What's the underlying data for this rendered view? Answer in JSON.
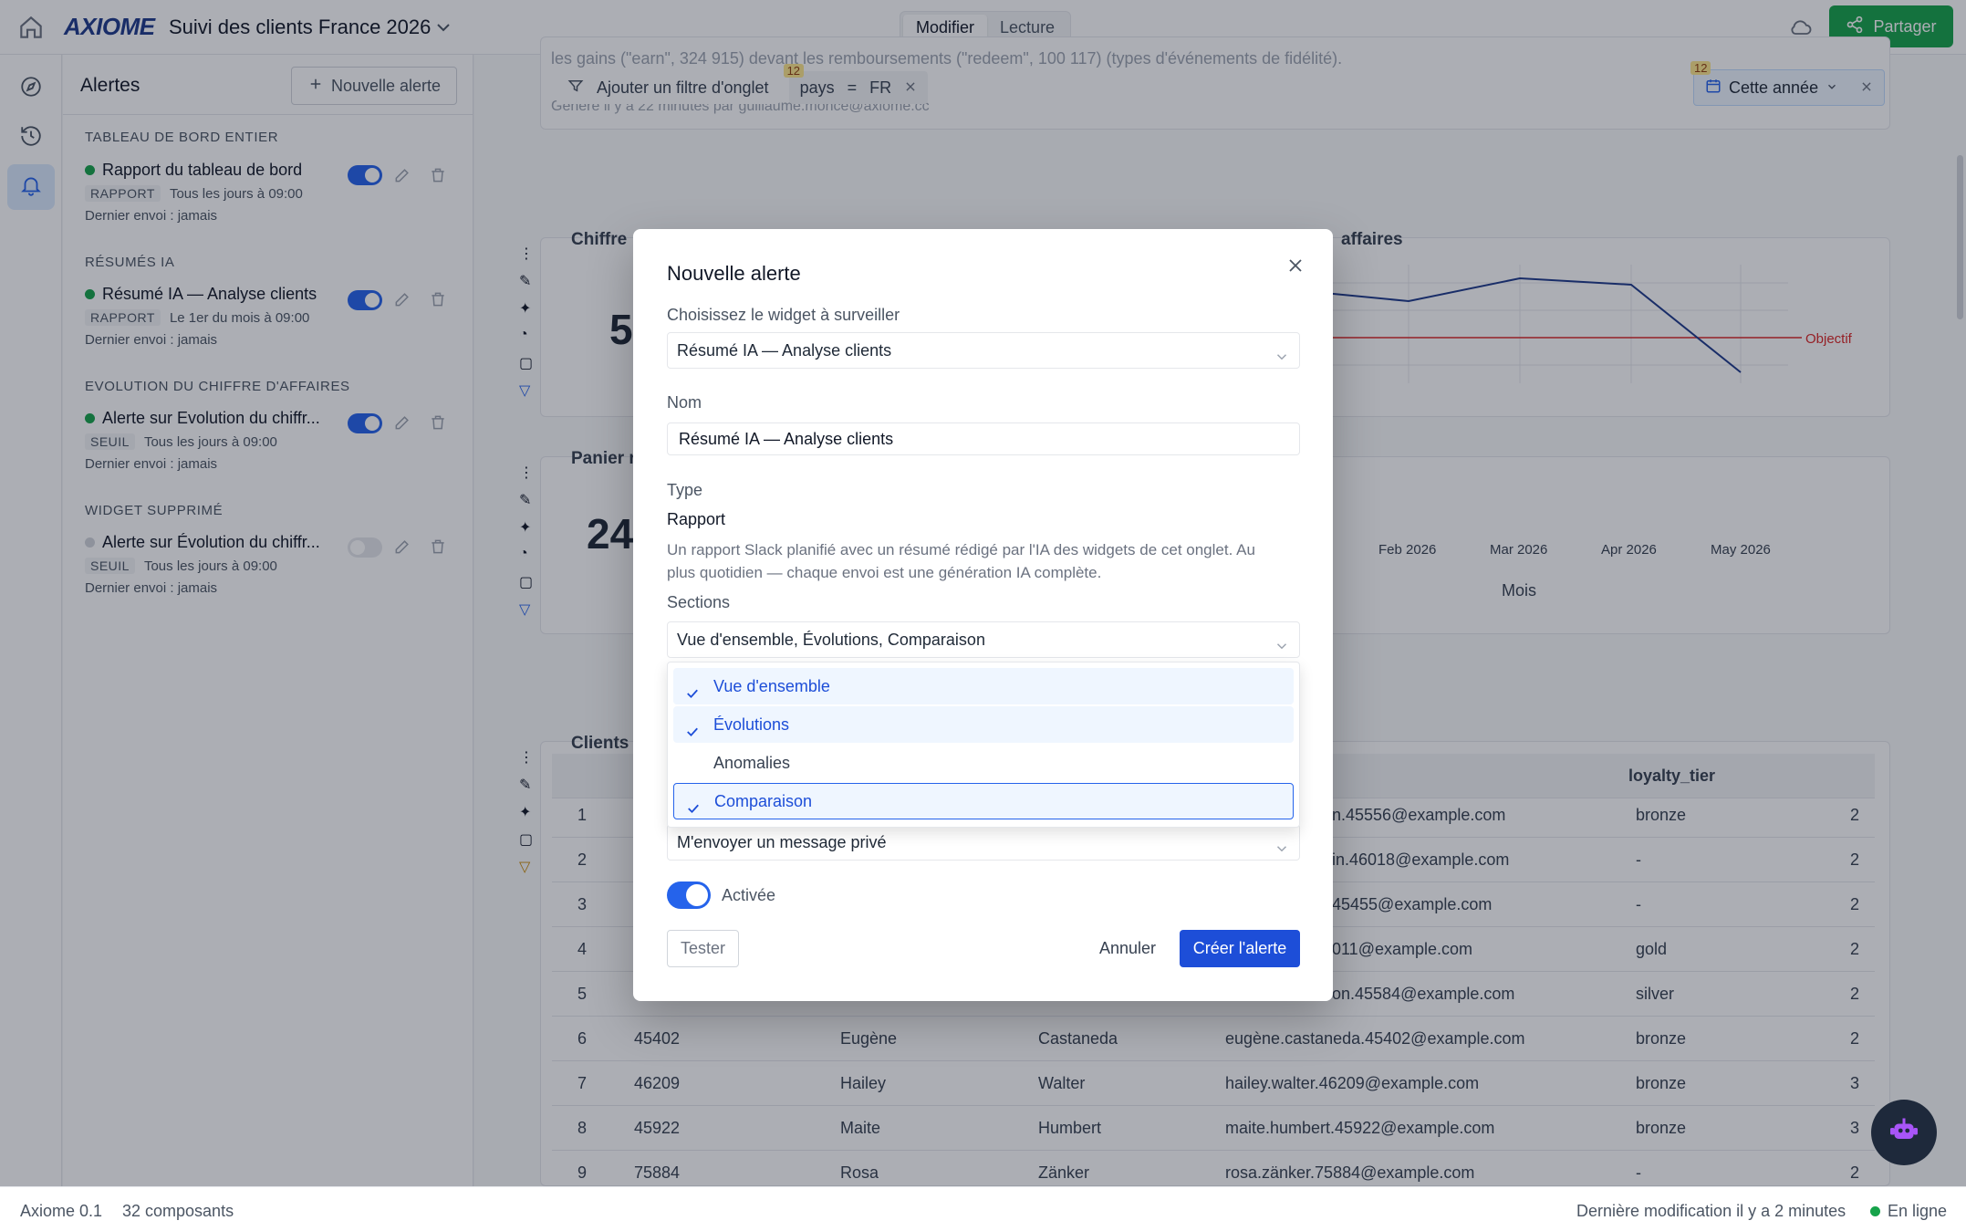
{
  "topbar": {
    "logo": "AXIOME",
    "dashboard_title": "Suivi des clients France 2026",
    "mode_edit": "Modifier",
    "mode_read": "Lecture",
    "share_label": "Partager"
  },
  "alerts_panel": {
    "title": "Alertes",
    "new_alert_label": "Nouvelle alerte",
    "sections": [
      {
        "title": "TABLEAU DE BORD ENTIER",
        "alert": {
          "name": "Rapport du tableau de bord",
          "badge": "RAPPORT",
          "schedule": "Tous les jours à 09:00",
          "last": "Dernier envoi : jamais",
          "enabled": true
        }
      },
      {
        "title": "RÉSUMÉS IA",
        "alert": {
          "name": "Résumé IA — Analyse clients",
          "badge": "RAPPORT",
          "schedule": "Le 1er du mois à 09:00",
          "last": "Dernier envoi : jamais",
          "enabled": true
        }
      },
      {
        "title": "EVOLUTION DU CHIFFRE D'AFFAIRES",
        "alert": {
          "name": "Alerte sur Evolution du chiffr...",
          "badge": "SEUIL",
          "schedule": "Tous les jours à 09:00",
          "last": "Dernier envoi : jamais",
          "enabled": true
        }
      },
      {
        "title": "WIDGET SUPPRIMÉ",
        "alert": {
          "name": "Alerte sur Évolution du chiffr...",
          "badge": "SEUIL",
          "schedule": "Tous les jours à 09:00",
          "last": "Dernier envoi : jamais",
          "enabled": false
        }
      }
    ]
  },
  "dashboard": {
    "faded_line1": "les gains (\"earn\", 324 915) devant les remboursements (\"redeem\", 100 117) (types d'événements de fidélité).",
    "faded_line2": "Généré il y a 22 minutes par guillaume.monce@axiome.cc",
    "add_filter_label": "Ajouter un filtre d'onglet",
    "filter_count": "12",
    "filter_field": "pays",
    "filter_op": "=",
    "filter_value": "FR",
    "date_count": "12",
    "date_label": "Cette année",
    "widget1_title": "Chiffre",
    "widget1_title_right": "affaires",
    "widget1_value": "5",
    "widget2_title": "Panier r",
    "widget2_value": "24",
    "widget3_title": "Clients a",
    "objective_label": "Objectif",
    "x_ticks": [
      "Feb 2026",
      "Mar 2026",
      "Apr 2026",
      "May 2026"
    ],
    "x_axis_label": "Mois",
    "table": {
      "col_header": "loyalty_tier",
      "rows": [
        {
          "n": "1",
          "id": "",
          "first": "",
          "last": "",
          "email": "n.45556@example.com",
          "tier": "bronze",
          "x": "2"
        },
        {
          "n": "2",
          "id": "",
          "first": "",
          "last": "",
          "email": "in.46018@example.com",
          "tier": "-",
          "x": "2"
        },
        {
          "n": "3",
          "id": "",
          "first": "",
          "last": "",
          "email": "45455@example.com",
          "tier": "-",
          "x": "2"
        },
        {
          "n": "4",
          "id": "",
          "first": "",
          "last": "",
          "email": "011@example.com",
          "tier": "gold",
          "x": "2"
        },
        {
          "n": "5",
          "id": "",
          "first": "",
          "last": "",
          "email": "on.45584@example.com",
          "tier": "silver",
          "x": "2"
        },
        {
          "n": "6",
          "id": "45402",
          "first": "Eugène",
          "last": "Castaneda",
          "email": "eugène.castaneda.45402@example.com",
          "tier": "bronze",
          "x": "2"
        },
        {
          "n": "7",
          "id": "46209",
          "first": "Hailey",
          "last": "Walter",
          "email": "hailey.walter.46209@example.com",
          "tier": "bronze",
          "x": "3"
        },
        {
          "n": "8",
          "id": "45922",
          "first": "Maite",
          "last": "Humbert",
          "email": "maite.humbert.45922@example.com",
          "tier": "bronze",
          "x": "3"
        },
        {
          "n": "9",
          "id": "75884",
          "first": "Rosa",
          "last": "Zänker",
          "email": "rosa.zänker.75884@example.com",
          "tier": "-",
          "x": "2"
        }
      ]
    }
  },
  "modal": {
    "title": "Nouvelle alerte",
    "widget_label": "Choisissez le widget à surveiller",
    "widget_value": "Résumé IA — Analyse clients",
    "name_label": "Nom",
    "name_value": "Résumé IA — Analyse clients",
    "type_label": "Type",
    "type_value": "Rapport",
    "type_desc": "Un rapport Slack planifié avec un résumé rédigé par l'IA des widgets de cet onglet. Au plus quotidien — chaque envoi est une génération IA complète.",
    "sections_label": "Sections",
    "sections_value": "Vue d'ensemble, Évolutions, Comparaison",
    "section_options": [
      {
        "label": "Vue d'ensemble",
        "checked": true
      },
      {
        "label": "Évolutions",
        "checked": true
      },
      {
        "label": "Anomalies",
        "checked": false
      },
      {
        "label": "Comparaison",
        "checked": true
      }
    ],
    "delivery_value": "M'envoyer un message privé",
    "enabled_label": "Activée",
    "test_label": "Tester",
    "cancel_label": "Annuler",
    "create_label": "Créer l'alerte"
  },
  "statusbar": {
    "version": "Axiome 0.1",
    "components": "32 composants",
    "last_modified": "Dernière modification il y a 2 minutes",
    "online": "En ligne"
  },
  "colors": {
    "accent": "#2563eb",
    "share": "#16a34a",
    "objective": "#dc2626"
  }
}
